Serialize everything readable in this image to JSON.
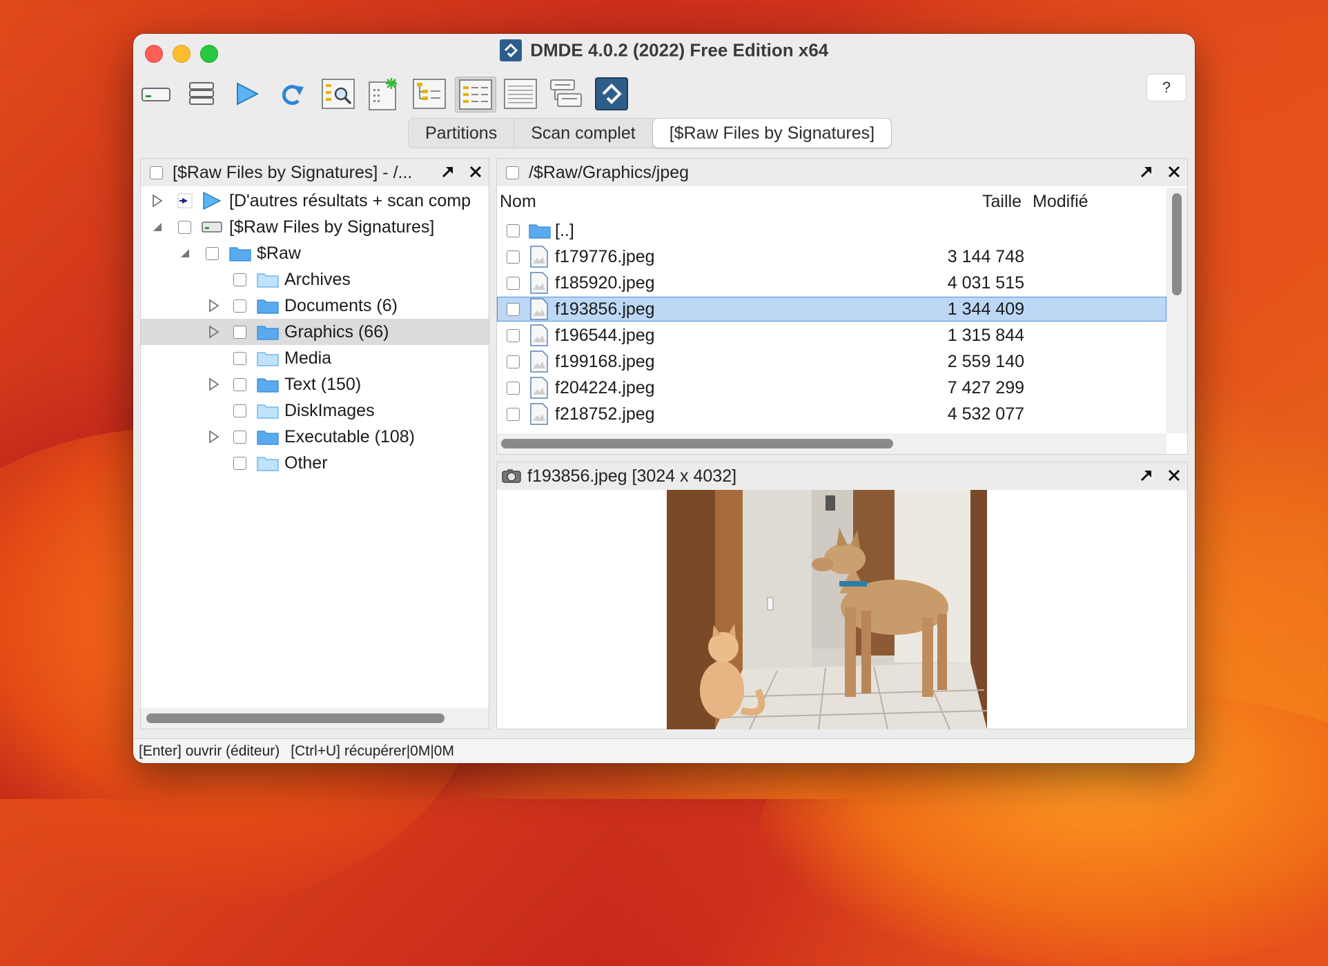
{
  "window": {
    "title": "DMDE 4.0.2 (2022) Free Edition x64",
    "close_color": "#fe5f57",
    "minimize_color": "#febc2e",
    "zoom_color": "#28c840"
  },
  "toolbar": {
    "buttons": [
      {
        "icon": "drive-icon"
      },
      {
        "icon": "partitions-icon"
      },
      {
        "icon": "play-icon"
      },
      {
        "icon": "refresh-icon"
      },
      {
        "icon": "find-icon"
      },
      {
        "icon": "new-panel-icon"
      },
      {
        "icon": "tree-view-icon"
      },
      {
        "icon": "list-view-icon",
        "active": true
      },
      {
        "icon": "details-view-icon"
      },
      {
        "icon": "split-view-icon"
      },
      {
        "icon": "dmde-logo-icon"
      }
    ],
    "help_label": "?"
  },
  "tabs": [
    {
      "label": "Partitions",
      "active": false
    },
    {
      "label": "Scan complet",
      "active": false
    },
    {
      "label": "[$Raw Files by Signatures]",
      "active": true
    }
  ],
  "left_panel": {
    "title": "[$Raw Files by Signatures] - /...",
    "tree": [
      {
        "label": "[D'autres résultats + scan comp",
        "kind": "more-results"
      },
      {
        "label": "[$Raw Files by Signatures]",
        "kind": "drive"
      },
      {
        "label": "$Raw",
        "kind": "folder"
      },
      {
        "label": "Archives",
        "kind": "folder-light"
      },
      {
        "label": "Documents (6)",
        "kind": "folder"
      },
      {
        "label": "Graphics (66)",
        "kind": "folder",
        "selected": true
      },
      {
        "label": "Media",
        "kind": "folder-light"
      },
      {
        "label": "Text (150)",
        "kind": "folder"
      },
      {
        "label": "DiskImages",
        "kind": "folder-light"
      },
      {
        "label": "Executable (108)",
        "kind": "folder"
      },
      {
        "label": "Other",
        "kind": "folder-light"
      }
    ]
  },
  "file_panel": {
    "path": "/$Raw/Graphics/jpeg",
    "columns": {
      "name": "Nom",
      "size": "Taille",
      "modified": "Modifié"
    },
    "rows": [
      {
        "name": "[..]",
        "size": "",
        "type": "parent"
      },
      {
        "name": "f179776.jpeg",
        "size": "3 144 748"
      },
      {
        "name": "f185920.jpeg",
        "size": "4 031 515"
      },
      {
        "name": "f193856.jpeg",
        "size": "1 344 409",
        "selected": true
      },
      {
        "name": "f196544.jpeg",
        "size": "1 315 844"
      },
      {
        "name": "f199168.jpeg",
        "size": "2 559 140"
      },
      {
        "name": "f204224.jpeg",
        "size": "7 427 299"
      },
      {
        "name": "f218752.jpeg",
        "size": "4 532 077"
      }
    ]
  },
  "preview_panel": {
    "title": "f193856.jpeg [3024 x 4032]"
  },
  "status": {
    "enter_hint": "[Enter] ouvrir (éditeur)",
    "recover_hint": "[Ctrl+U] récupérer|0M|0M"
  },
  "colors": {
    "selection": "#bdd8f5",
    "selection_border": "#4a8fe0",
    "folder": "#5aaaf0",
    "accent": "#2f5d8a"
  }
}
